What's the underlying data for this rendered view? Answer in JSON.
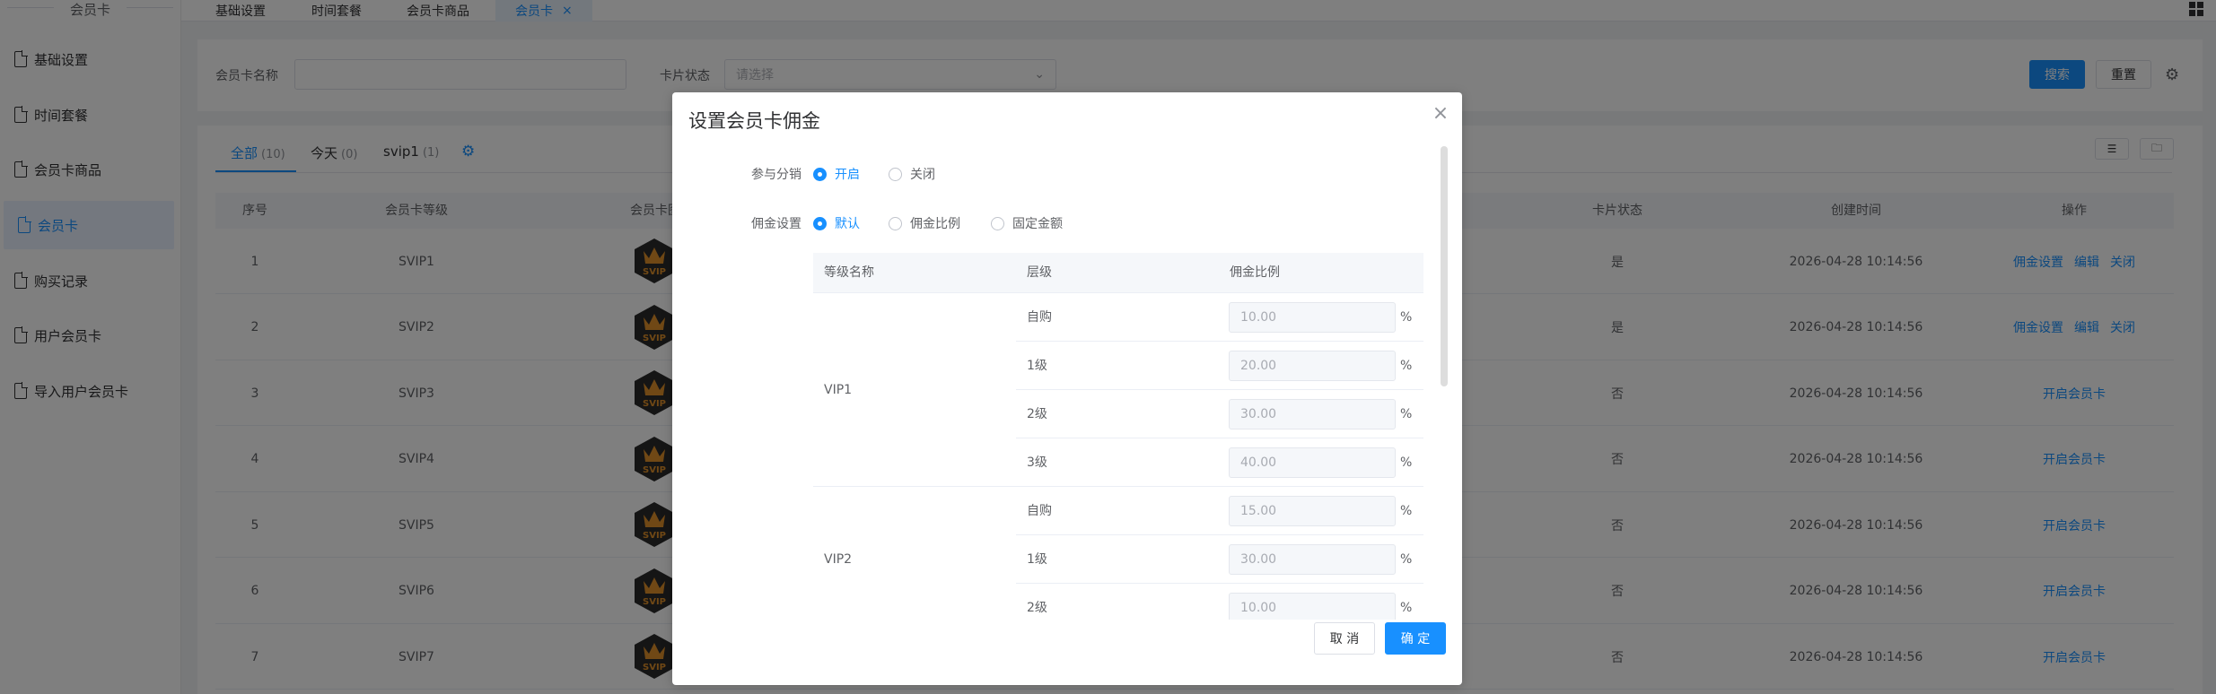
{
  "sidebar": {
    "title": "会员卡",
    "items": [
      {
        "label": "基础设置",
        "active": false
      },
      {
        "label": "时间套餐",
        "active": false
      },
      {
        "label": "会员卡商品",
        "active": false
      },
      {
        "label": "会员卡",
        "active": true
      },
      {
        "label": "购买记录",
        "active": false
      },
      {
        "label": "用户会员卡",
        "active": false
      },
      {
        "label": "导入用户会员卡",
        "active": false
      }
    ]
  },
  "tabs": [
    {
      "label": "基础设置"
    },
    {
      "label": "时间套餐"
    },
    {
      "label": "会员卡商品"
    },
    {
      "label": "会员卡",
      "close": "×"
    }
  ],
  "search": {
    "name_label": "会员卡名称",
    "name_value": "",
    "status_label": "卡片状态",
    "status_placeholder": "请选择",
    "search_button": "搜索",
    "reset_button": "重置"
  },
  "list_tabs": [
    {
      "label": "全部",
      "count": "(10)"
    },
    {
      "label": "今天",
      "count": "(0)"
    },
    {
      "label": "svip1",
      "count": "(1)"
    }
  ],
  "table": {
    "headers": [
      "序号",
      "会员卡等级",
      "会员卡图",
      "卡片状态",
      "创建时间",
      "操作"
    ],
    "rows": [
      {
        "no": "1",
        "level": "SVIP1",
        "status": "是",
        "created": "2026-04-28 10:14:56",
        "actions": [
          "佣金设置",
          "编辑",
          "关闭"
        ]
      },
      {
        "no": "2",
        "level": "SVIP2",
        "status": "是",
        "created": "2026-04-28 10:14:56",
        "actions": [
          "佣金设置",
          "编辑",
          "关闭"
        ]
      },
      {
        "no": "3",
        "level": "SVIP3",
        "status": "否",
        "created": "2026-04-28 10:14:56",
        "actions": [
          "开启会员卡"
        ]
      },
      {
        "no": "4",
        "level": "SVIP4",
        "status": "否",
        "created": "2026-04-28 10:14:56",
        "actions": [
          "开启会员卡"
        ]
      },
      {
        "no": "5",
        "level": "SVIP5",
        "status": "否",
        "created": "2026-04-28 10:14:56",
        "actions": [
          "开启会员卡"
        ]
      },
      {
        "no": "6",
        "level": "SVIP6",
        "status": "否",
        "created": "2026-04-28 10:14:56",
        "actions": [
          "开启会员卡"
        ]
      },
      {
        "no": "7",
        "level": "SVIP7",
        "status": "否",
        "created": "2026-04-28 10:14:56",
        "actions": [
          "开启会员卡"
        ]
      }
    ],
    "badge_text": "SVIP"
  },
  "dialog": {
    "title": "设置会员卡佣金",
    "close": "×",
    "distribution_label": "参与分销",
    "distribution_options": [
      {
        "label": "开启",
        "checked": true
      },
      {
        "label": "关闭",
        "checked": false
      }
    ],
    "commission_label": "佣金设置",
    "commission_options": [
      {
        "label": "默认",
        "checked": true
      },
      {
        "label": "佣金比例",
        "checked": false
      },
      {
        "label": "固定金额",
        "checked": false
      }
    ],
    "table_headers": [
      "等级名称",
      "层级",
      "佣金比例"
    ],
    "groups": [
      {
        "name": "VIP1",
        "tiers": [
          {
            "tier": "自购",
            "value": "10.00",
            "unit": "%"
          },
          {
            "tier": "1级",
            "value": "20.00",
            "unit": "%"
          },
          {
            "tier": "2级",
            "value": "30.00",
            "unit": "%"
          },
          {
            "tier": "3级",
            "value": "40.00",
            "unit": "%"
          }
        ]
      },
      {
        "name": "VIP2",
        "tiers": [
          {
            "tier": "自购",
            "value": "15.00",
            "unit": "%"
          },
          {
            "tier": "1级",
            "value": "30.00",
            "unit": "%"
          },
          {
            "tier": "2级",
            "value": "10.00",
            "unit": "%"
          }
        ]
      }
    ],
    "cancel_button": "取 消",
    "confirm_button": "确 定"
  },
  "colors": {
    "accent": "#1890ff",
    "badge_bg": "#2b2b2b",
    "badge_text": "#e0902a"
  }
}
